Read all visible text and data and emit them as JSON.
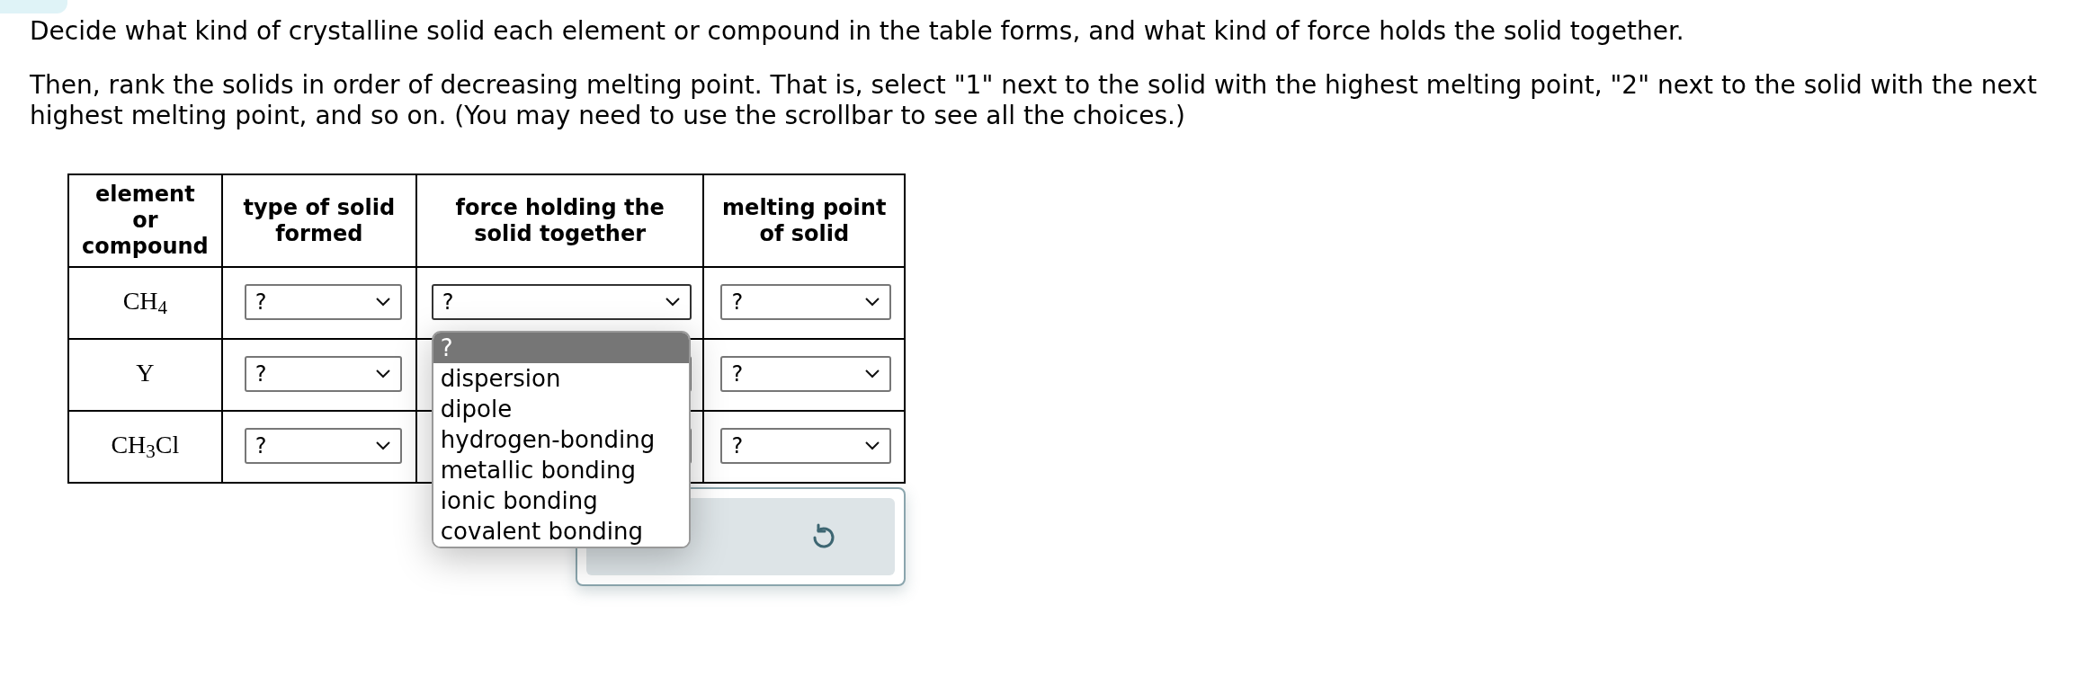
{
  "instructions": [
    "Decide what kind of crystalline solid each element or compound in the table forms, and what kind of force holds the solid together.",
    "Then, rank the solids in order of decreasing melting point. That is, select \"1\" next to the solid with the highest melting point, \"2\" next to the solid with the next highest melting point, and so on. (You may need to use the scrollbar to see all the choices.)"
  ],
  "table": {
    "columns": [
      "element or compound",
      "type of solid formed",
      "force holding the solid together",
      "melting point of solid"
    ],
    "rows": [
      {
        "compound": "CH$_{4}$",
        "type": {
          "value": "?",
          "expanded": false
        },
        "force": {
          "value": "?",
          "expanded": true
        },
        "melting": {
          "value": "?",
          "expanded": false
        }
      },
      {
        "compound": "Y",
        "type": {
          "value": "?",
          "expanded": false
        },
        "force": {
          "expanded": false
        },
        "melting": {
          "value": "?",
          "expanded": false
        }
      },
      {
        "compound": "CH$_{3}$Cl",
        "type": {
          "value": "?",
          "expanded": false
        },
        "force": {
          "expanded": false
        },
        "melting": {
          "value": "?",
          "expanded": false
        }
      }
    ]
  },
  "dropdown_options": [
    {
      "label": "?",
      "selected": true
    },
    {
      "label": "dispersion",
      "selected": false
    },
    {
      "label": "dipole",
      "selected": false
    },
    {
      "label": "hydrogen-bonding",
      "selected": false
    },
    {
      "label": "metallic bonding",
      "selected": false
    },
    {
      "label": "ionic bonding",
      "selected": false
    },
    {
      "label": "covalent bonding",
      "selected": false
    }
  ]
}
